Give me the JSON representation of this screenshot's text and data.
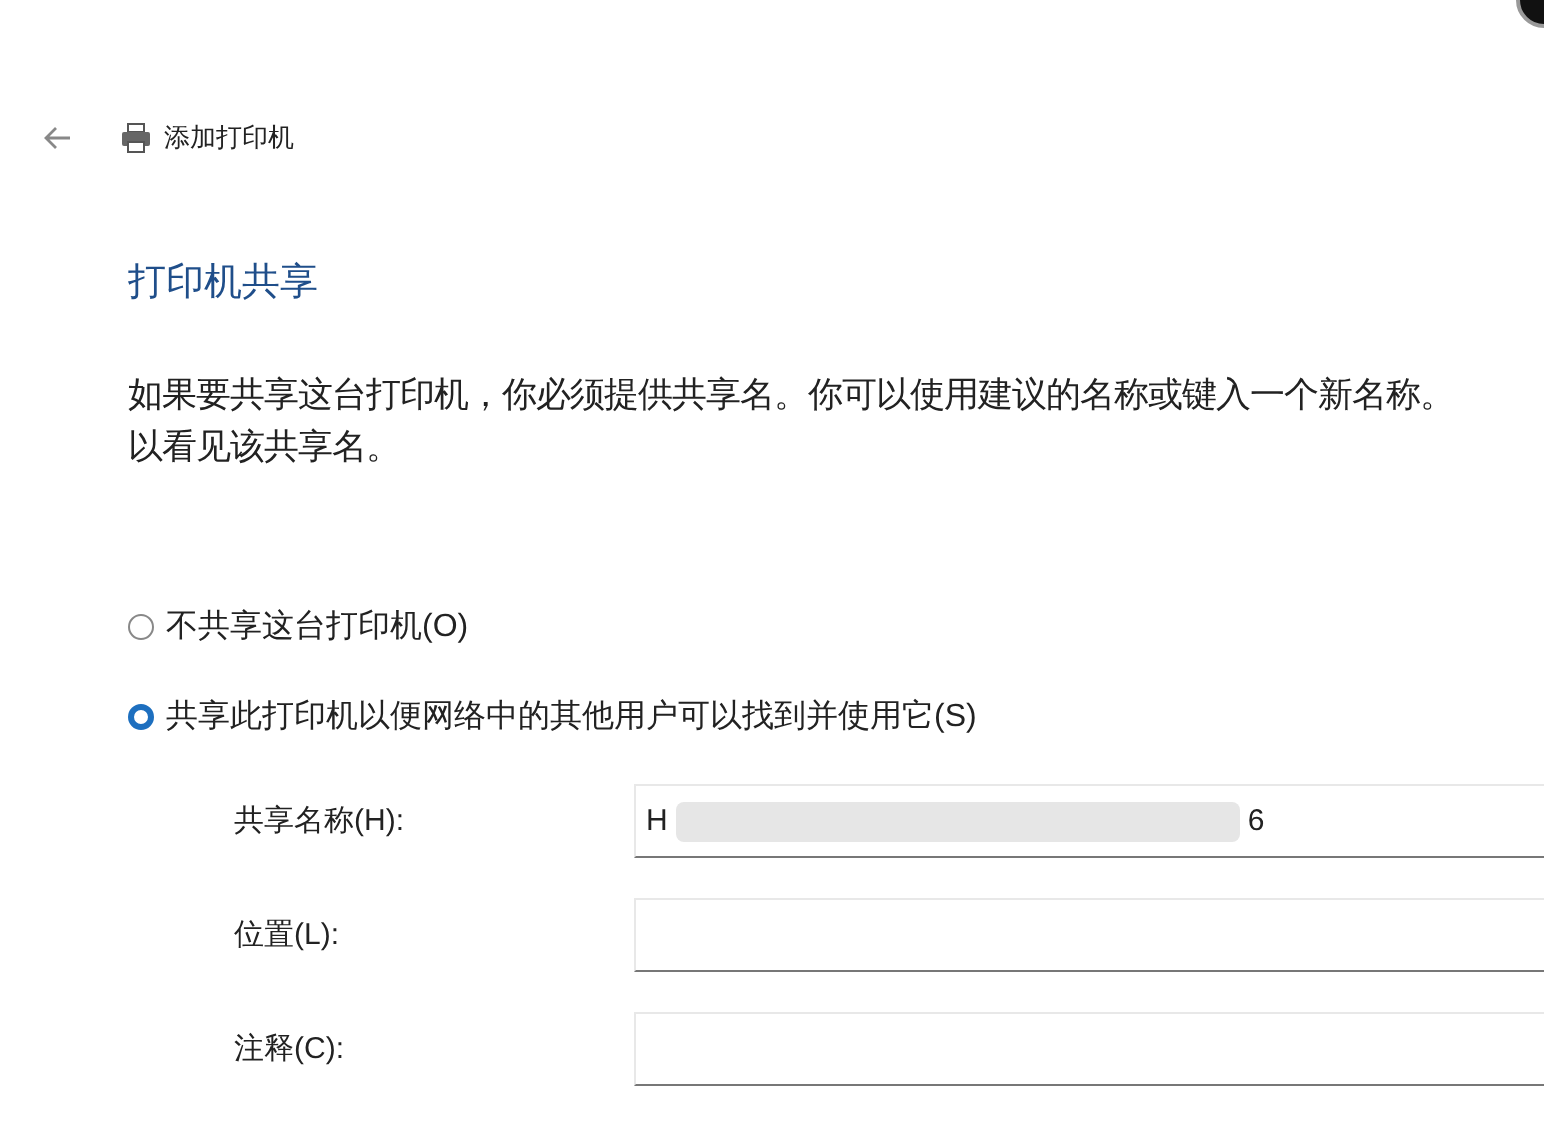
{
  "header": {
    "title": "添加打印机"
  },
  "heading": "打印机共享",
  "description": [
    "如果要共享这台打印机，你必须提供共享名。你可以使用建议的名称或键入一个新名称。",
    "以看见该共享名。"
  ],
  "options": [
    {
      "label": "不共享这台打印机(O)",
      "selected": false
    },
    {
      "label": "共享此打印机以便网络中的其他用户可以找到并使用它(S)",
      "selected": true
    }
  ],
  "fields": [
    {
      "label": "共享名称(H):",
      "value_start": "H",
      "value_end": "6",
      "redacted": true
    },
    {
      "label": "位置(L):"
    },
    {
      "label": "注释(C):"
    }
  ]
}
